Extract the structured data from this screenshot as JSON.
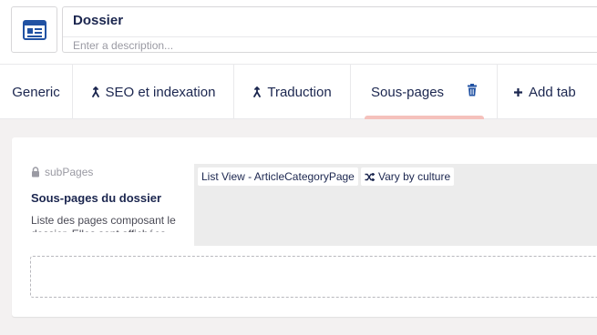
{
  "header": {
    "icon": "document-icon",
    "name": "Dossier",
    "description_placeholder": "Enter a description..."
  },
  "tabs": [
    {
      "label": "Generic",
      "icon": null
    },
    {
      "label": "SEO et indexation",
      "icon": "drag-handle-icon"
    },
    {
      "label": "Traduction",
      "icon": "drag-handle-icon"
    },
    {
      "label": "Sous-pages",
      "icon": null,
      "active": true
    },
    {
      "label": "Add tab",
      "icon": "plus-icon"
    }
  ],
  "property": {
    "alias": "subPages",
    "label": "Sous-pages du dossier",
    "description": "Liste des pages composant le dossier. Elles sont affichées",
    "editor_tag": "List View - ArticleCategoryPage",
    "variation_tag": "Vary by culture"
  },
  "colors": {
    "accent_underline": "#f5c1bc",
    "text": "#1b264f",
    "icon_blue": "#2152a3"
  }
}
